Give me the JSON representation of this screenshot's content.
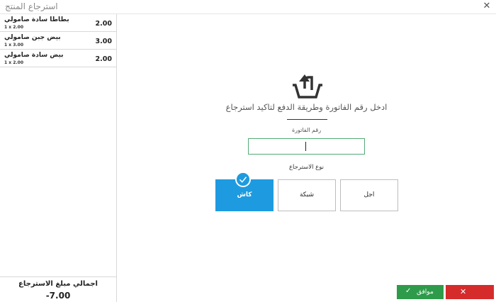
{
  "window": {
    "title": "استرجاع المنتج"
  },
  "items": [
    {
      "name": "بطاطا سادة صامولي",
      "qty": "1 x 2.00",
      "price": "2.00"
    },
    {
      "name": "بيض جبن صامولي",
      "qty": "1 x 3.00",
      "price": "3.00"
    },
    {
      "name": "بيض سادة صامولي",
      "qty": "1 x 2.00",
      "price": "2.00"
    }
  ],
  "total": {
    "label": "اجمالي مبلغ الاسترجاع",
    "value": "-7.00"
  },
  "main": {
    "instructions": "ادخل رقم الفاتورة وطريقة الدفع لتاكيد استرجاع",
    "invoice_label": "رقم الفاتورة",
    "invoice_value": "",
    "refund_type_label": "نوع الاسترجاع",
    "options": {
      "cash": "كاش",
      "network": "شبكة",
      "later": "اجل"
    },
    "selected_option": "cash"
  },
  "buttons": {
    "ok": "موافق"
  },
  "colors": {
    "accent": "#1e9be0",
    "ok": "#2e9b4a",
    "cancel": "#d52b2b",
    "input_border": "#55aa77"
  },
  "icons": {
    "refund": "basket-return-icon",
    "close": "close-icon",
    "check": "check-icon",
    "cancel": "cancel-x-icon"
  }
}
